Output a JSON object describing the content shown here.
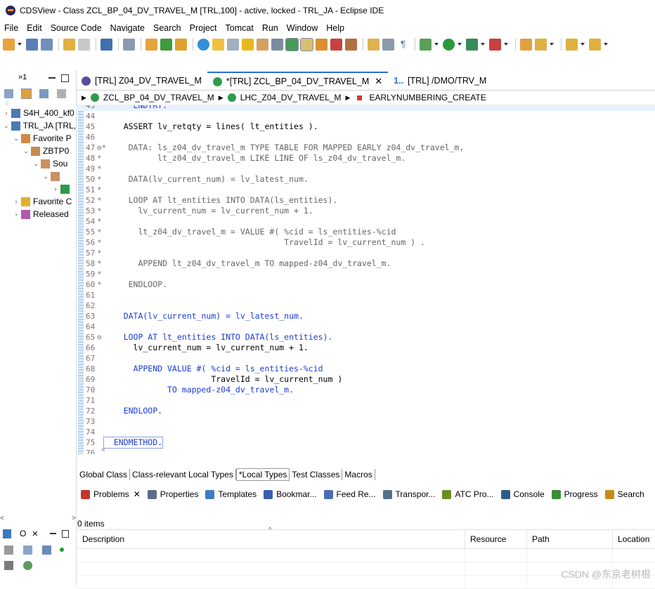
{
  "window": {
    "title": "CDSView - Class ZCL_BP_04_DV_TRAVEL_M [TRL,100] - active, locked - TRL_JA - Eclipse IDE"
  },
  "menu": [
    "File",
    "Edit",
    "Source Code",
    "Navigate",
    "Search",
    "Project",
    "Tomcat",
    "Run",
    "Window",
    "Help"
  ],
  "left_panel": {
    "tab_marker": "»1",
    "tree": [
      {
        "label": "S4H_400_kf0",
        "indent": 0,
        "expanded": false
      },
      {
        "label": "TRL_JA [TRL,",
        "indent": 0,
        "expanded": true
      },
      {
        "label": "Favorite P",
        "indent": 1,
        "expanded": true
      },
      {
        "label": "ZBTP0",
        "indent": 2,
        "expanded": true
      },
      {
        "label": "Sou",
        "indent": 3,
        "expanded": true
      },
      {
        "label": "",
        "indent": 4,
        "expanded": true
      },
      {
        "label": "",
        "indent": 5,
        "expanded": false
      },
      {
        "label": "Favorite C",
        "indent": 1,
        "expanded": false
      },
      {
        "label": "Released",
        "indent": 1,
        "expanded": false
      }
    ]
  },
  "outline_panel": {
    "title": "O"
  },
  "editor": {
    "tabs": [
      {
        "label": "[TRL] Z04_DV_TRAVEL_M",
        "active": false
      },
      {
        "label": "*[TRL] ZCL_BP_04_DV_TRAVEL_M",
        "active": true
      },
      {
        "label": "[TRL] /DMO/TRV_M",
        "active": false
      }
    ],
    "tab_overflow": "1..",
    "breadcrumb": [
      "ZCL_BP_04_DV_TRAVEL_M",
      "LHC_Z04_DV_TRAVEL_M",
      "EARLYNUMBERING_CREATE"
    ],
    "lines": [
      {
        "n": "43",
        "m": "",
        "t": "      ENDTRY."
      },
      {
        "n": "44",
        "m": "",
        "t": ""
      },
      {
        "n": "45",
        "m": "",
        "t": "    ASSERT lv_retqty = lines( lt_entities )."
      },
      {
        "n": "46",
        "m": "",
        "t": ""
      },
      {
        "n": "47",
        "m": "⊖*",
        "t": "     DATA: ls_z04_dv_travel_m TYPE TABLE FOR MAPPED EARLY z04_dv_travel_m,"
      },
      {
        "n": "48",
        "m": "*",
        "t": "           lt_z04_dv_travel_m LIKE LINE OF ls_z04_dv_travel_m."
      },
      {
        "n": "49",
        "m": "*",
        "t": ""
      },
      {
        "n": "50",
        "m": "*",
        "t": "     DATA(lv_current_num) = lv_latest_num."
      },
      {
        "n": "51",
        "m": "*",
        "t": ""
      },
      {
        "n": "52",
        "m": "*",
        "t": "     LOOP AT lt_entities INTO DATA(ls_entities)."
      },
      {
        "n": "53",
        "m": "*",
        "t": "       lv_current_num = lv_current_num + 1."
      },
      {
        "n": "54",
        "m": "*",
        "t": ""
      },
      {
        "n": "55",
        "m": "*",
        "t": "       lt_z04_dv_travel_m = VALUE #( %cid = ls_entities-%cid"
      },
      {
        "n": "56",
        "m": "*",
        "t": "                                     TravelId = lv_current_num ) ."
      },
      {
        "n": "57",
        "m": "*",
        "t": ""
      },
      {
        "n": "58",
        "m": "*",
        "t": "       APPEND lt_z04_dv_travel_m TO mapped-z04_dv_travel_m."
      },
      {
        "n": "59",
        "m": "*",
        "t": ""
      },
      {
        "n": "60",
        "m": "*",
        "t": "     ENDLOOP."
      },
      {
        "n": "61",
        "m": "",
        "t": ""
      },
      {
        "n": "62",
        "m": "",
        "t": ""
      },
      {
        "n": "63",
        "m": "",
        "t": "    DATA(lv_current_num) = lv_latest_num."
      },
      {
        "n": "64",
        "m": "",
        "t": ""
      },
      {
        "n": "65",
        "m": "⊖",
        "t": "    LOOP AT lt_entities INTO DATA(ls_entities)."
      },
      {
        "n": "66",
        "m": "",
        "t": "      lv_current_num = lv_current_num + 1."
      },
      {
        "n": "67",
        "m": "",
        "t": ""
      },
      {
        "n": "68",
        "m": "",
        "t": "      APPEND VALUE #( %cid = ls_entities-%cid"
      },
      {
        "n": "69",
        "m": "",
        "t": "                      TravelId = lv_current_num )"
      },
      {
        "n": "70",
        "m": "",
        "t": "             TO mapped-z04_dv_travel_m."
      },
      {
        "n": "71",
        "m": "",
        "t": ""
      },
      {
        "n": "72",
        "m": "",
        "t": "    ENDLOOP."
      },
      {
        "n": "73",
        "m": "",
        "t": ""
      },
      {
        "n": "74",
        "m": "",
        "t": ""
      },
      {
        "n": "75",
        "m": "",
        "t": "  ENDMETHOD."
      },
      {
        "n": "76",
        "m": "",
        "t": ""
      }
    ]
  },
  "source_tabs": [
    {
      "label": "Global Class",
      "active": false
    },
    {
      "label": "Class-relevant Local Types",
      "active": false
    },
    {
      "label": "*Local Types",
      "active": true
    },
    {
      "label": "Test Classes",
      "active": false
    },
    {
      "label": "Macros",
      "active": false
    }
  ],
  "bottom_panel": {
    "tabs": [
      {
        "label": "Problems",
        "color": "#c0392b",
        "closable": true
      },
      {
        "label": "Properties",
        "color": "#5b6f8a"
      },
      {
        "label": "Templates",
        "color": "#3e7bc4"
      },
      {
        "label": "Bookmar...",
        "color": "#3a5fb0"
      },
      {
        "label": "Feed Re...",
        "color": "#4a6db3"
      },
      {
        "label": "Transpor...",
        "color": "#52708a"
      },
      {
        "label": "ATC Pro...",
        "color": "#6b8e23"
      },
      {
        "label": "Console",
        "color": "#2f5d8a"
      },
      {
        "label": "Progress",
        "color": "#3c8d3c"
      },
      {
        "label": "Search",
        "color": "#c98b1b"
      }
    ],
    "item_count": "0 items",
    "columns": [
      "Description",
      "Resource",
      "Path",
      "Location"
    ]
  },
  "watermark": "CSDN @东京老树根"
}
